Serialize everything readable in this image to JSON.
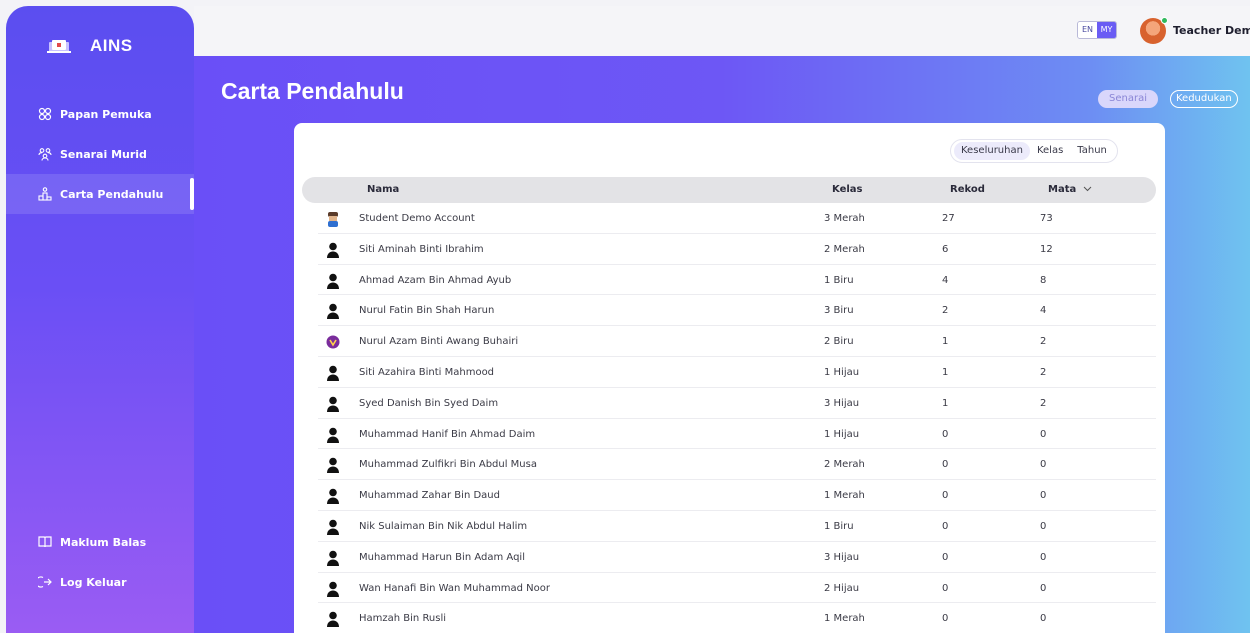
{
  "app": {
    "name": "AINS"
  },
  "sidebar": {
    "items": [
      {
        "label": "Papan Pemuka",
        "icon": "dashboard-icon"
      },
      {
        "label": "Senarai Murid",
        "icon": "students-icon"
      },
      {
        "label": "Carta Pendahulu",
        "icon": "leaderboard-icon",
        "active": true
      }
    ],
    "bottom": [
      {
        "label": "Maklum Balas",
        "icon": "book-icon"
      },
      {
        "label": "Log Keluar",
        "icon": "logout-icon"
      }
    ]
  },
  "header": {
    "lang_en": "EN",
    "lang_my": "MY",
    "user_name": "Teacher Demo"
  },
  "page": {
    "title": "Carta Pendahulu",
    "view_list": "Senarai",
    "view_rank": "Kedudukan"
  },
  "filters": [
    "Keseluruhan",
    "Kelas",
    "Tahun"
  ],
  "table": {
    "columns": {
      "name": "Nama",
      "kelas": "Kelas",
      "rekod": "Rekod",
      "mata": "Mata"
    },
    "rows": [
      {
        "avatar": "custom-avatar-1",
        "name": "Student Demo Account",
        "kelas": "3 Merah",
        "rekod": "27",
        "mata": "73"
      },
      {
        "avatar": "default-user-icon",
        "name": "Siti Aminah Binti Ibrahim",
        "kelas": "2 Merah",
        "rekod": "6",
        "mata": "12"
      },
      {
        "avatar": "default-user-icon",
        "name": "Ahmad Azam Bin Ahmad Ayub",
        "kelas": "1 Biru",
        "rekod": "4",
        "mata": "8"
      },
      {
        "avatar": "default-user-icon",
        "name": "Nurul Fatin Bin Shah Harun",
        "kelas": "3 Biru",
        "rekod": "2",
        "mata": "4"
      },
      {
        "avatar": "custom-avatar-2",
        "name": "Nurul Azam Binti Awang Buhairi",
        "kelas": "2 Biru",
        "rekod": "1",
        "mata": "2"
      },
      {
        "avatar": "default-user-icon",
        "name": "Siti Azahira Binti Mahmood",
        "kelas": "1 Hijau",
        "rekod": "1",
        "mata": "2"
      },
      {
        "avatar": "default-user-icon",
        "name": "Syed Danish Bin Syed Daim",
        "kelas": "3 Hijau",
        "rekod": "1",
        "mata": "2"
      },
      {
        "avatar": "default-user-icon",
        "name": "Muhammad Hanif Bin Ahmad Daim",
        "kelas": "1 Hijau",
        "rekod": "0",
        "mata": "0"
      },
      {
        "avatar": "default-user-icon",
        "name": "Muhammad Zulfikri Bin Abdul Musa",
        "kelas": "2 Merah",
        "rekod": "0",
        "mata": "0"
      },
      {
        "avatar": "default-user-icon",
        "name": "Muhammad Zahar Bin Daud",
        "kelas": "1 Merah",
        "rekod": "0",
        "mata": "0"
      },
      {
        "avatar": "default-user-icon",
        "name": "Nik Sulaiman Bin Nik Abdul Halim",
        "kelas": "1 Biru",
        "rekod": "0",
        "mata": "0"
      },
      {
        "avatar": "default-user-icon",
        "name": "Muhammad Harun Bin Adam Aqil",
        "kelas": "3 Hijau",
        "rekod": "0",
        "mata": "0"
      },
      {
        "avatar": "default-user-icon",
        "name": "Wan Hanafi Bin Wan Muhammad Noor",
        "kelas": "2 Hijau",
        "rekod": "0",
        "mata": "0"
      },
      {
        "avatar": "default-user-icon",
        "name": "Hamzah Bin Rusli",
        "kelas": "1 Merah",
        "rekod": "0",
        "mata": "0"
      }
    ]
  },
  "colors": {
    "accent": "#6a4ff7",
    "gradient_end": "#6fc3f0"
  }
}
